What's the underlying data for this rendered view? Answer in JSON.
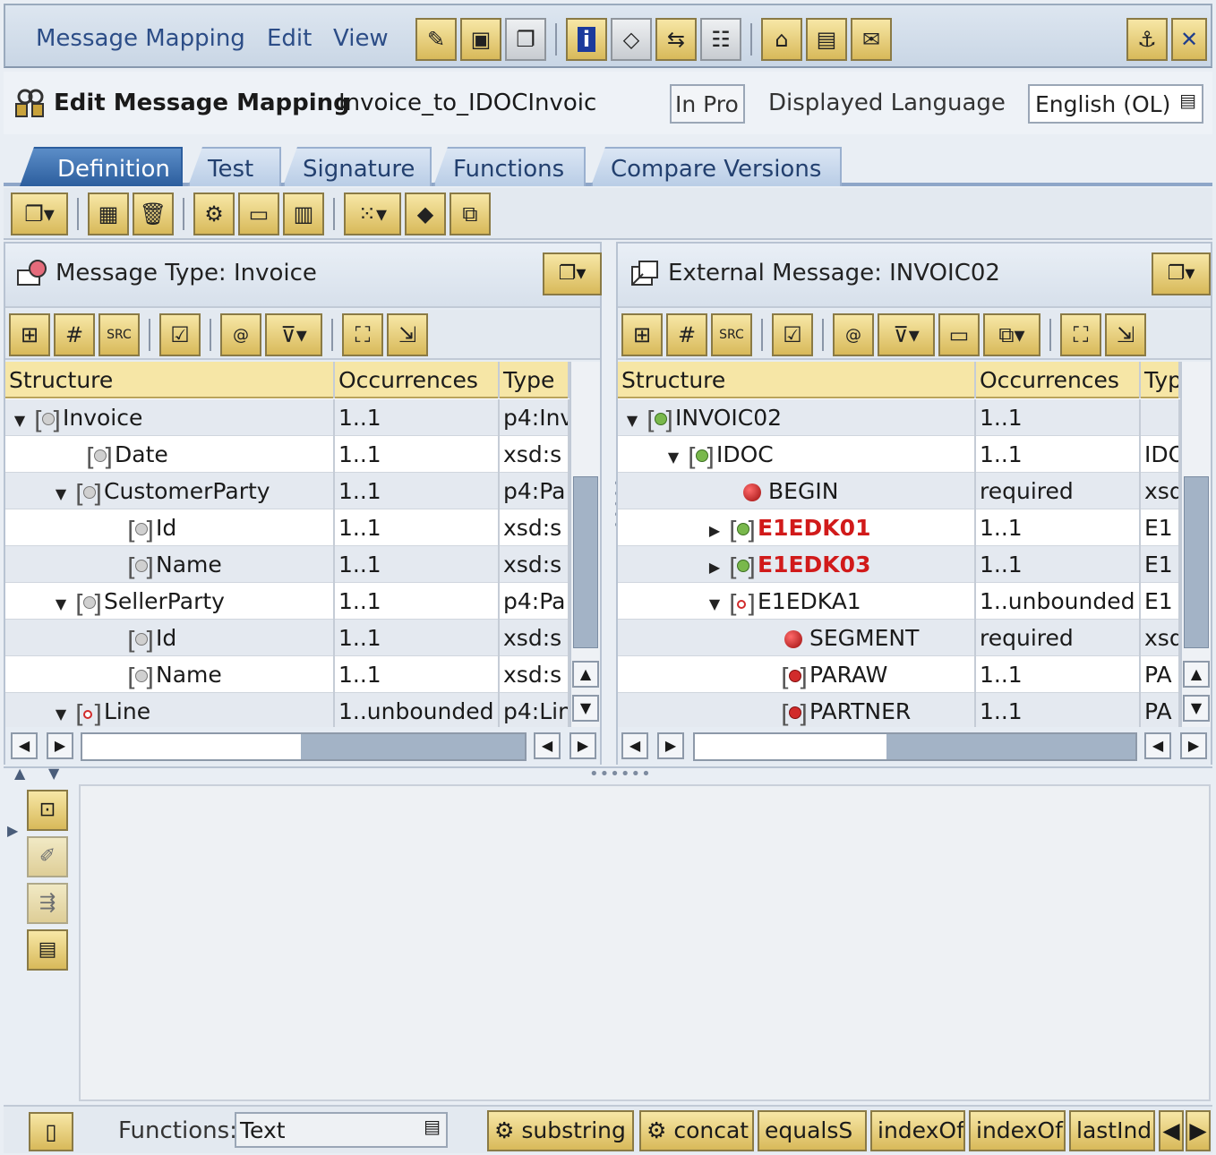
{
  "menu": {
    "message_mapping": "Message Mapping",
    "edit": "Edit",
    "view": "View"
  },
  "header": {
    "title": "Edit Message Mapping",
    "mapping_name": "Invoice_to_IDOCInvoic",
    "status": "In Pro",
    "lang_label": "Displayed Language",
    "lang_value": "English (OL)"
  },
  "tabs": [
    {
      "label": "Definition",
      "active": true
    },
    {
      "label": "Test"
    },
    {
      "label": "Signature"
    },
    {
      "label": "Functions"
    },
    {
      "label": "Compare Versions"
    }
  ],
  "source": {
    "title": "Message Type: Invoice",
    "columns": [
      "Structure",
      "Occurrences",
      "Type"
    ],
    "rows": [
      {
        "name": "Invoice",
        "occ": "1..1",
        "type": "p4:Inv",
        "expand": "open"
      },
      {
        "name": "Date",
        "occ": "1..1",
        "type": "xsd:s"
      },
      {
        "name": "CustomerParty",
        "occ": "1..1",
        "type": "p4:Pa",
        "expand": "open"
      },
      {
        "name": "Id",
        "occ": "1..1",
        "type": "xsd:s"
      },
      {
        "name": "Name",
        "occ": "1..1",
        "type": "xsd:s"
      },
      {
        "name": "SellerParty",
        "occ": "1..1",
        "type": "p4:Pa",
        "expand": "open"
      },
      {
        "name": "Id",
        "occ": "1..1",
        "type": "xsd:s"
      },
      {
        "name": "Name",
        "occ": "1..1",
        "type": "xsd:s"
      },
      {
        "name": "Line",
        "occ": "1..unbounded",
        "type": "p4:Lin",
        "expand": "open"
      }
    ]
  },
  "target": {
    "title": "External Message: INVOIC02",
    "columns": [
      "Structure",
      "Occurrences",
      "Typ"
    ],
    "rows": [
      {
        "name": "INVOIC02",
        "occ": "1..1",
        "type": "",
        "expand": "open"
      },
      {
        "name": "IDOC",
        "occ": "1..1",
        "type": "IDO",
        "expand": "open"
      },
      {
        "name": "BEGIN",
        "occ": "required",
        "type": "xsd"
      },
      {
        "name": "E1EDK01",
        "occ": "1..1",
        "type": "E1",
        "expand": "closed"
      },
      {
        "name": "E1EDK03",
        "occ": "1..1",
        "type": "E1",
        "expand": "closed"
      },
      {
        "name": "E1EDKA1",
        "occ": "1..unbounded",
        "type": "E1",
        "expand": "open"
      },
      {
        "name": "SEGMENT",
        "occ": "required",
        "type": "xsd"
      },
      {
        "name": "PARAW",
        "occ": "1..1",
        "type": "PA"
      },
      {
        "name": "PARTNER",
        "occ": "1..1",
        "type": "PA"
      }
    ]
  },
  "functions": {
    "label": "Functions:",
    "category": "Text",
    "buttons": [
      "substring",
      "concat",
      "equalsS",
      "indexOf",
      "indexOf",
      "lastInd"
    ]
  }
}
